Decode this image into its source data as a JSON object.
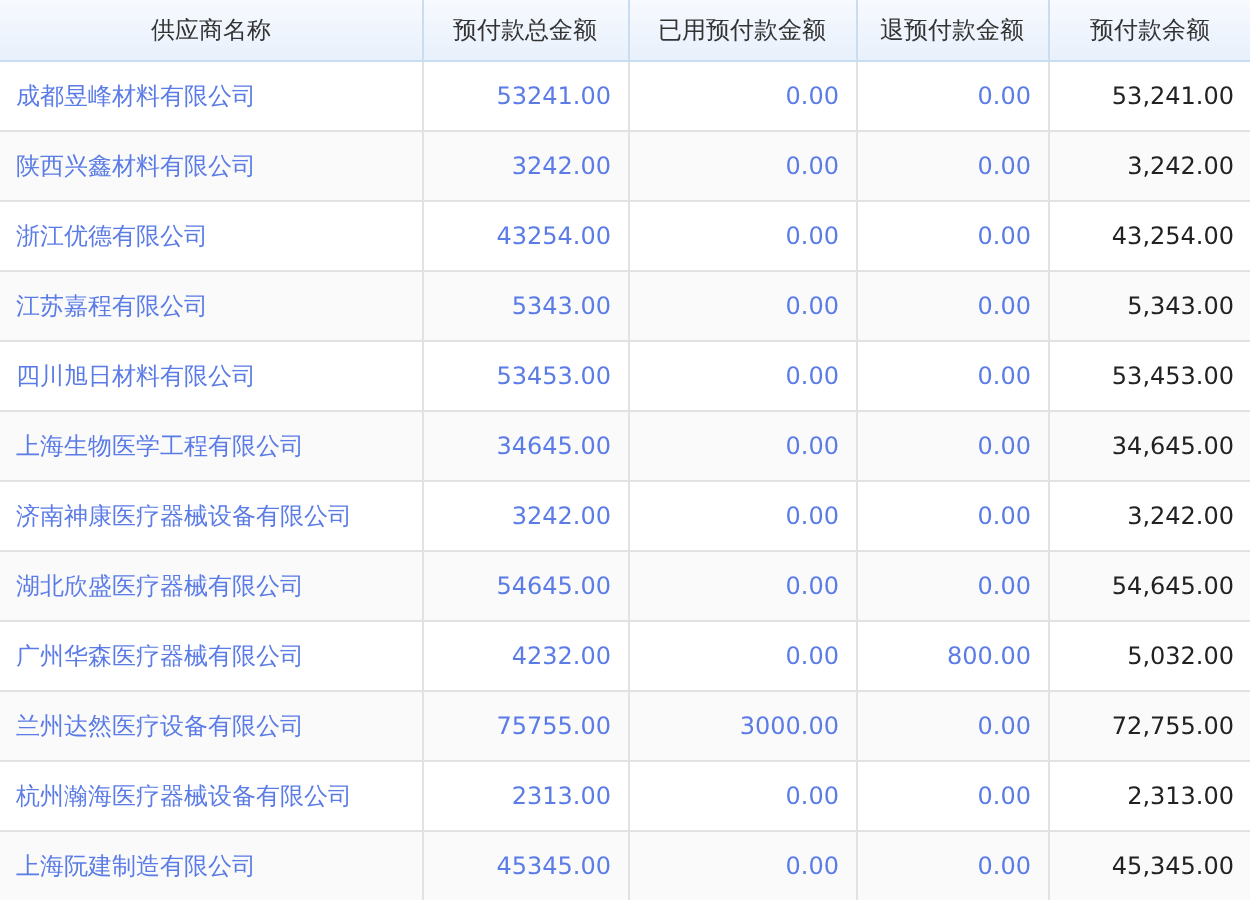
{
  "table": {
    "columns": [
      "供应商名称",
      "预付款总金额",
      "已用预付款金额",
      "退预付款金额",
      "预付款余额"
    ],
    "rows": [
      [
        "成都昱峰材料有限公司",
        "53241.00",
        "0.00",
        "0.00",
        "53,241.00"
      ],
      [
        "陕西兴鑫材料有限公司",
        "3242.00",
        "0.00",
        "0.00",
        "3,242.00"
      ],
      [
        "浙江优德有限公司",
        "43254.00",
        "0.00",
        "0.00",
        "43,254.00"
      ],
      [
        "江苏嘉程有限公司",
        "5343.00",
        "0.00",
        "0.00",
        "5,343.00"
      ],
      [
        "四川旭日材料有限公司",
        "53453.00",
        "0.00",
        "0.00",
        "53,453.00"
      ],
      [
        "上海生物医学工程有限公司",
        "34645.00",
        "0.00",
        "0.00",
        "34,645.00"
      ],
      [
        "济南神康医疗器械设备有限公司",
        "3242.00",
        "0.00",
        "0.00",
        "3,242.00"
      ],
      [
        "湖北欣盛医疗器械有限公司",
        "54645.00",
        "0.00",
        "0.00",
        "54,645.00"
      ],
      [
        "广州华森医疗器械有限公司",
        "4232.00",
        "0.00",
        "800.00",
        "5,032.00"
      ],
      [
        "兰州达然医疗设备有限公司",
        "75755.00",
        "3000.00",
        "0.00",
        "72,755.00"
      ],
      [
        "杭州瀚海医疗器械设备有限公司",
        "2313.00",
        "0.00",
        "0.00",
        "2,313.00"
      ],
      [
        "上海阮建制造有限公司",
        "45345.00",
        "0.00",
        "0.00",
        "45,345.00"
      ]
    ]
  }
}
